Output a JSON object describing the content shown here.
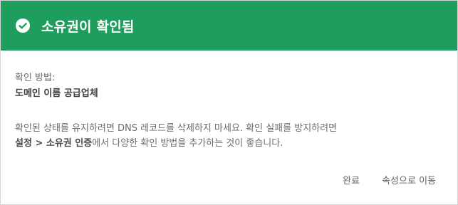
{
  "dialog": {
    "title": "소유권이 확인됨",
    "method_label": "확인 방법:",
    "method_value": "도메인 이름 공급업체",
    "note": {
      "line1": "확인된 상태를 유지하려면 DNS 레코드를 삭제하지 마세요. 확인 실패를 방지하려면",
      "emphasis": "설정 > 소유권 인증",
      "line2_rest": "에서 다양한 확인 방법을 추가하는 것이 좋습니다."
    },
    "actions": {
      "done_label": "완료",
      "go_to_property_label": "속성으로 이동"
    },
    "colors": {
      "header_bg": "#1e9e5c",
      "header_text": "#ffffff"
    },
    "icons": {
      "header_icon": "check-circle-icon"
    }
  }
}
